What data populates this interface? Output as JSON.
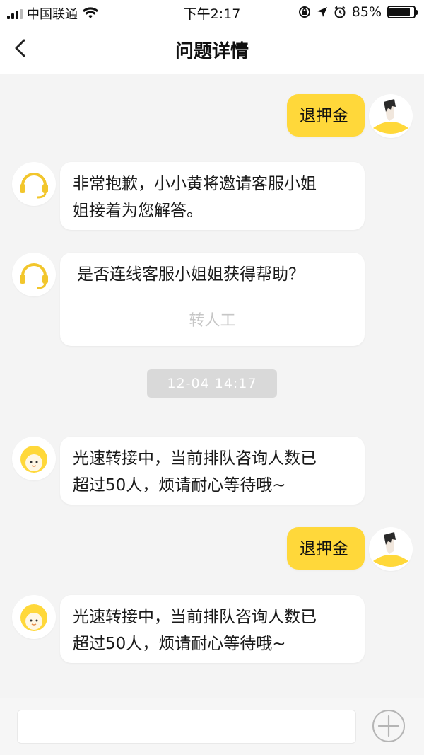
{
  "status_bar": {
    "carrier": "中国联通",
    "time": "下午2:17",
    "battery": "85%",
    "battery_level": 0.85,
    "icons": [
      "signal-icon",
      "wifi-icon",
      "orientation-lock-icon",
      "location-icon",
      "alarm-icon",
      "battery-icon"
    ]
  },
  "nav": {
    "title": "问题详情",
    "back_icon": "chevron-left-icon"
  },
  "messages": [
    {
      "from": "user",
      "text": "退押金",
      "avatar": "user-avatar"
    },
    {
      "from": "bot",
      "text_line1": "非常抱歉，小小黄将邀请客服小姐",
      "text_line2": "姐接着为您解答。",
      "avatar": "headset-icon"
    },
    {
      "from": "bot",
      "question": "是否连线客服小姐姐获得帮助？",
      "button": "转人工",
      "avatar": "headset-icon"
    },
    {
      "timestamp": "12-04 14:17"
    },
    {
      "from": "agent",
      "text_line1": "光速转接中，当前排队咨询人数已",
      "text_line2": "超过50人，烦请耐心等待哦~",
      "avatar": "agent-avatar"
    },
    {
      "from": "user",
      "text": "退押金",
      "avatar": "user-avatar"
    },
    {
      "from": "agent",
      "text_line1": "光速转接中，当前排队咨询人数已",
      "text_line2": "超过50人，烦请耐心等待哦~",
      "avatar": "agent-avatar"
    }
  ],
  "input": {
    "value": "",
    "placeholder": "",
    "plus_icon": "plus-circle-icon"
  },
  "colors": {
    "accent_yellow": "#ffd83a",
    "background": "#f4f4f4",
    "bubble": "#ffffff",
    "icon_yellow": "#f2c62c"
  }
}
